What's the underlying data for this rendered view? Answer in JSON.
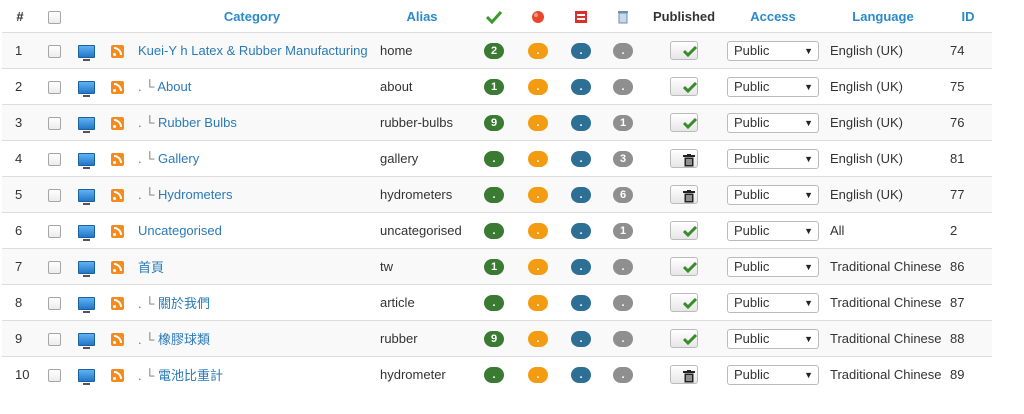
{
  "headers": {
    "num": "#",
    "category": "Category",
    "alias": "Alias",
    "published": "Published",
    "access": "Access",
    "language": "Language",
    "id": "ID"
  },
  "header_icons": [
    "published-count-check-icon",
    "unpublished-count-dot-icon",
    "archived-count-box-icon",
    "trashed-count-bin-icon"
  ],
  "rows": [
    {
      "num": "1",
      "prefix": "",
      "category": "Kuei-Y h Latex & Rubber Manufacturing",
      "alias": "home",
      "c_pub": "2",
      "c_unpub": ".",
      "c_arch": ".",
      "c_trash": ".",
      "state": "published",
      "access": "Public",
      "language": "English (UK)",
      "id": "74"
    },
    {
      "num": "2",
      "prefix": ". └ ",
      "category": "About",
      "alias": "about",
      "c_pub": "1",
      "c_unpub": ".",
      "c_arch": ".",
      "c_trash": ".",
      "state": "published",
      "access": "Public",
      "language": "English (UK)",
      "id": "75"
    },
    {
      "num": "3",
      "prefix": ". └ ",
      "category": "Rubber Bulbs",
      "alias": "rubber-bulbs",
      "c_pub": "9",
      "c_unpub": ".",
      "c_arch": ".",
      "c_trash": "1",
      "state": "published",
      "access": "Public",
      "language": "English (UK)",
      "id": "76"
    },
    {
      "num": "4",
      "prefix": ". └ ",
      "category": "Gallery",
      "alias": "gallery",
      "c_pub": ".",
      "c_unpub": ".",
      "c_arch": ".",
      "c_trash": "3",
      "state": "trashed",
      "access": "Public",
      "language": "English (UK)",
      "id": "81"
    },
    {
      "num": "5",
      "prefix": ". └ ",
      "category": "Hydrometers",
      "alias": "hydrometers",
      "c_pub": ".",
      "c_unpub": ".",
      "c_arch": ".",
      "c_trash": "6",
      "state": "trashed",
      "access": "Public",
      "language": "English (UK)",
      "id": "77"
    },
    {
      "num": "6",
      "prefix": "",
      "category": "Uncategorised",
      "alias": "uncategorised",
      "c_pub": ".",
      "c_unpub": ".",
      "c_arch": ".",
      "c_trash": "1",
      "state": "published",
      "access": "Public",
      "language": "All",
      "id": "2"
    },
    {
      "num": "7",
      "prefix": "",
      "category": "首頁",
      "alias": "tw",
      "c_pub": "1",
      "c_unpub": ".",
      "c_arch": ".",
      "c_trash": ".",
      "state": "published",
      "access": "Public",
      "language": "Traditional Chinese",
      "id": "86"
    },
    {
      "num": "8",
      "prefix": ". └ ",
      "category": "關於我們",
      "alias": "article",
      "c_pub": ".",
      "c_unpub": ".",
      "c_arch": ".",
      "c_trash": ".",
      "state": "published",
      "access": "Public",
      "language": "Traditional Chinese",
      "id": "87"
    },
    {
      "num": "9",
      "prefix": ". └ ",
      "category": "橡膠球類",
      "alias": "rubber",
      "c_pub": "9",
      "c_unpub": ".",
      "c_arch": ".",
      "c_trash": ".",
      "state": "published",
      "access": "Public",
      "language": "Traditional Chinese",
      "id": "88"
    },
    {
      "num": "10",
      "prefix": ". └ ",
      "category": "電池比重計",
      "alias": "hydrometer",
      "c_pub": ".",
      "c_unpub": ".",
      "c_arch": ".",
      "c_trash": ".",
      "state": "trashed",
      "access": "Public",
      "language": "Traditional Chinese",
      "id": "89"
    }
  ],
  "colors": {
    "link": "#2a8bc8",
    "published": "#3a7a32",
    "unpublished": "#f39c12",
    "archived": "#2e6f96",
    "trashed": "#8f8f8f"
  }
}
